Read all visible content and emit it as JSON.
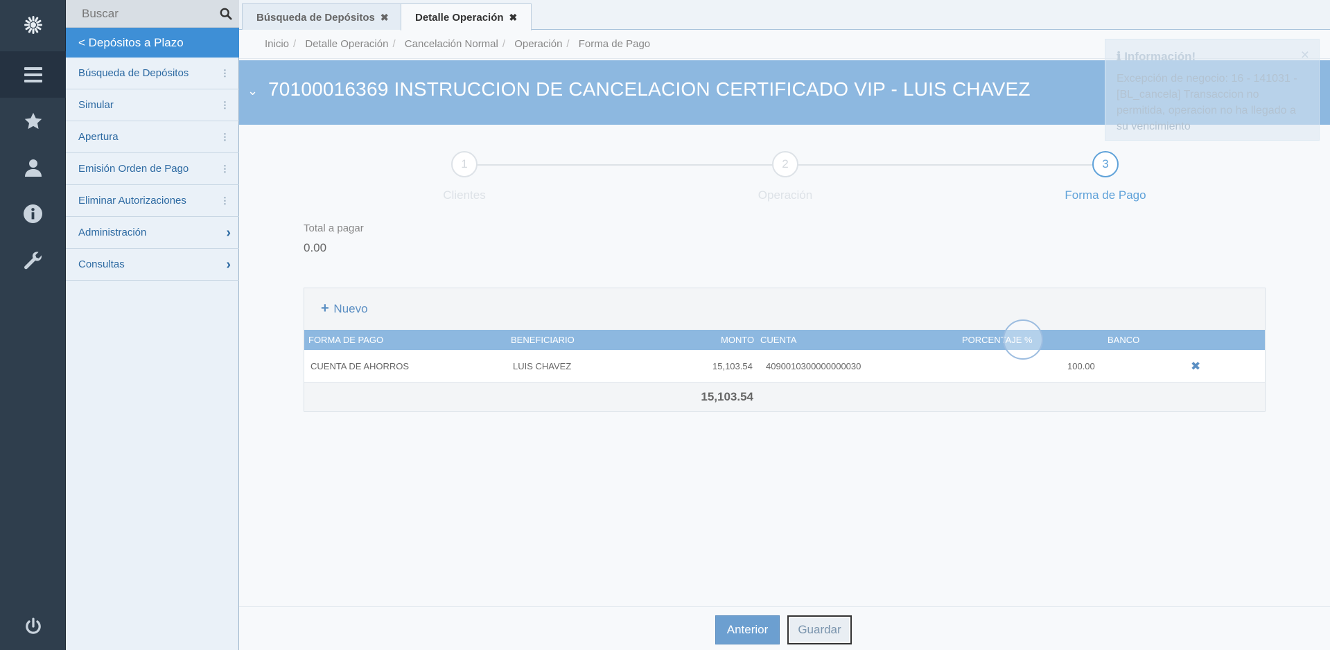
{
  "search": {
    "placeholder": "Buscar"
  },
  "sidebar": {
    "back_label": "< Depósitos a Plazo",
    "items": [
      {
        "label": "Búsqueda de Depósitos"
      },
      {
        "label": "Simular"
      },
      {
        "label": "Apertura"
      },
      {
        "label": "Emisión Orden de Pago"
      },
      {
        "label": "Eliminar Autorizaciones"
      },
      {
        "label": "Administración"
      },
      {
        "label": "Consultas"
      }
    ]
  },
  "tabs": [
    {
      "label": "Búsqueda de Depósitos"
    },
    {
      "label": "Detalle Operación"
    }
  ],
  "breadcrumb": [
    "Inicio",
    "Detalle Operación",
    "Cancelación Normal",
    "Operación",
    "Forma de Pago"
  ],
  "header": {
    "title": "70100016369  INSTRUCCION DE CANCELACION CERTIFICADO VIP -  LUIS CHAVEZ"
  },
  "wizard": {
    "steps": [
      {
        "number": "1",
        "label": "Clientes"
      },
      {
        "number": "2",
        "label": "Operación"
      },
      {
        "number": "3",
        "label": "Forma de Pago"
      }
    ]
  },
  "total": {
    "label": "Total a pagar",
    "value": "0.00"
  },
  "table": {
    "new_label": "Nuevo",
    "columns": [
      "FORMA DE PAGO",
      "BENEFICIARIO",
      "MONTO",
      "CUENTA",
      "PORCENTAJE %",
      "BANCO"
    ],
    "rows": [
      {
        "forma": "CUENTA DE AHORROS",
        "beneficiario": "LUIS CHAVEZ",
        "monto": "15,103.54",
        "cuenta": "4090010300000000030",
        "porcentaje": "100.00",
        "banco": ""
      }
    ],
    "total": "15,103.54"
  },
  "toast": {
    "title": "Información!",
    "message": "Excepción de negocio: 16 - 141031 - [BL_cancela] Transaccion no permitida, operacion no ha llegado a su vencimiento"
  },
  "footer": {
    "prev_label": "Anterior",
    "save_label": "Guardar"
  },
  "colors": {
    "accent": "#3e8fd6",
    "header": "#8db8e0",
    "rail": "#2f3e4d"
  }
}
